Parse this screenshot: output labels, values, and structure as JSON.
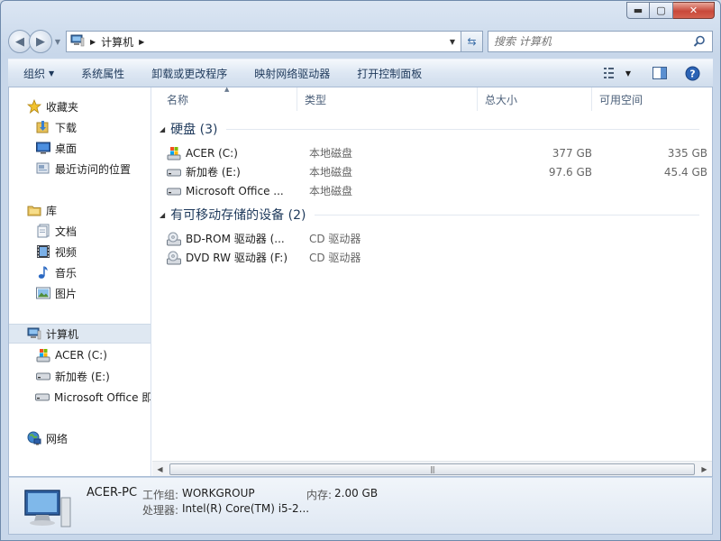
{
  "window": {
    "minimize": "▬",
    "maximize": "▢",
    "close": "✕"
  },
  "address": {
    "crumb": "计算机",
    "search_placeholder": "搜索 计算机"
  },
  "toolbar": {
    "organize": "组织",
    "system_properties": "系统属性",
    "uninstall": "卸载或更改程序",
    "map_drive": "映射网络驱动器",
    "control_panel": "打开控制面板"
  },
  "nav": {
    "favorites": "收藏夹",
    "downloads": "下载",
    "desktop": "桌面",
    "recent": "最近访问的位置",
    "libraries": "库",
    "documents": "文档",
    "videos": "视频",
    "music": "音乐",
    "pictures": "图片",
    "computer": "计算机",
    "drive_c": "ACER (C:)",
    "drive_e": "新加卷 (E:)",
    "drive_office": "Microsoft Office 即",
    "network": "网络"
  },
  "columns": {
    "name": "名称",
    "type": "类型",
    "total": "总大小",
    "free": "可用空间"
  },
  "groups": {
    "hard_disks": "硬盘 (3)",
    "removable": "有可移动存储的设备 (2)"
  },
  "drives": [
    {
      "name": "ACER (C:)",
      "type": "本地磁盘",
      "total": "377 GB",
      "free": "335 GB"
    },
    {
      "name": "新加卷 (E:)",
      "type": "本地磁盘",
      "total": "97.6 GB",
      "free": "45.4 GB"
    },
    {
      "name": "Microsoft Office ...",
      "type": "本地磁盘",
      "total": "",
      "free": ""
    }
  ],
  "removable_drives": [
    {
      "name": "BD-ROM 驱动器 (...",
      "type": "CD 驱动器"
    },
    {
      "name": "DVD RW 驱动器 (F:)",
      "type": "CD 驱动器"
    }
  ],
  "details": {
    "computer_name": "ACER-PC",
    "workgroup_label": "工作组:",
    "workgroup_value": "WORKGROUP",
    "memory_label": "内存:",
    "memory_value": "2.00 GB",
    "processor_label": "处理器:",
    "processor_value": "Intel(R) Core(TM) i5-2..."
  }
}
